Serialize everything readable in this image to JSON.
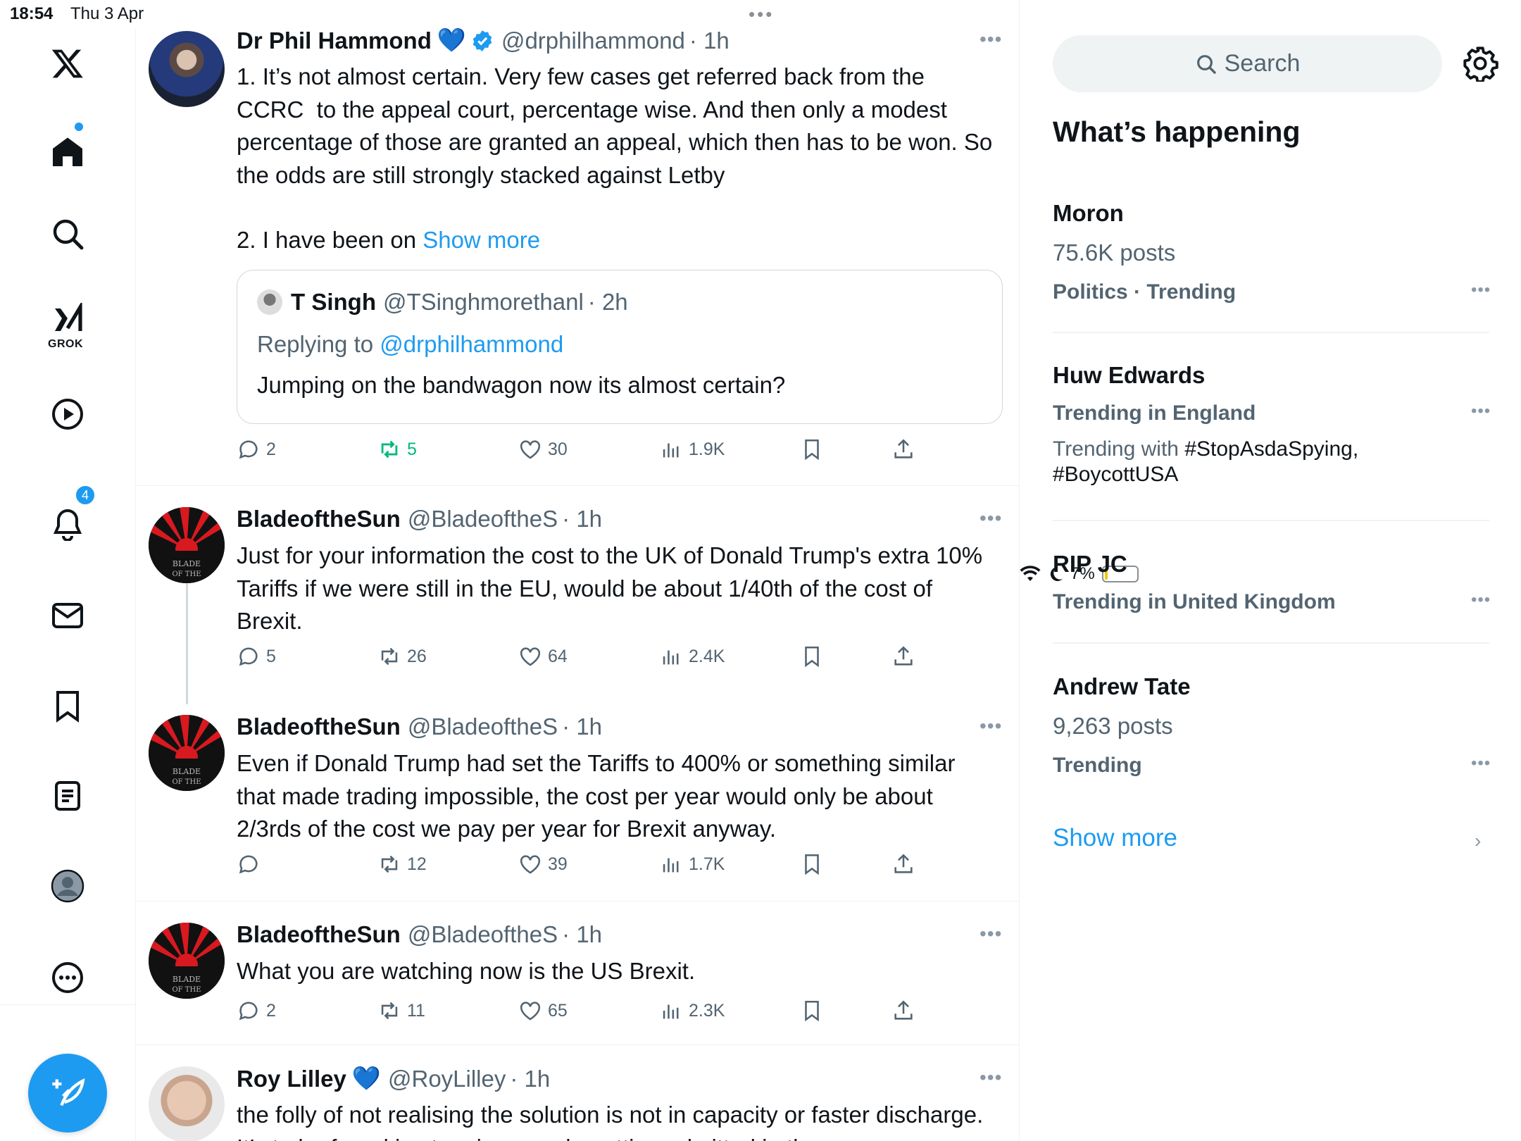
{
  "status_bar": {
    "time": "18:54",
    "date": "Thu 3 Apr",
    "battery": "7%"
  },
  "nav": {
    "grok_label": "GROK",
    "notifications_badge": "4"
  },
  "tweets": [
    {
      "name": "Dr Phil Hammond",
      "heart": "💙",
      "handle": "@drphilhammond",
      "time": "· 1h",
      "text": "1. It’s not almost certain. Very few cases get referred back from the CCRC  to the appeal court, percentage wise. And then only a modest percentage of those are granted an appeal, which then has to be won. So the odds are still strongly stacked against Letby",
      "text2": "2. I have been on ",
      "show_more": "Show more",
      "quote": {
        "name": "T Singh",
        "handle": "@TSinghmorethanl",
        "time": "· 2h",
        "replying_to": "Replying to ",
        "replying_handle": "@drphilhammond",
        "text": "Jumping on the bandwagon now its almost certain?"
      },
      "replies": "2",
      "reposts": "5",
      "likes": "30",
      "views": "1.9K"
    },
    {
      "name": "BladeoftheSun",
      "handle": "@BladeoftheS",
      "time": "· 1h",
      "text": "Just for your information the cost to the UK of Donald Trump's extra 10% Tariffs if we were still in the EU, would be about 1/40th of the cost of Brexit.",
      "replies": "5",
      "reposts": "26",
      "likes": "64",
      "views": "2.4K"
    },
    {
      "name": "BladeoftheSun",
      "handle": "@BladeoftheS",
      "time": "· 1h",
      "text": "Even if Donald Trump had set the Tariffs to 400% or something similar that made trading impossible, the cost per year would only be about 2/3rds of the cost we pay per year for Brexit anyway.",
      "replies": "",
      "reposts": "12",
      "likes": "39",
      "views": "1.7K"
    },
    {
      "name": "BladeoftheSun",
      "handle": "@BladeoftheS",
      "time": "· 1h",
      "text": "What you are watching now is the US Brexit.",
      "replies": "2",
      "reposts": "11",
      "likes": "65",
      "views": "2.3K"
    },
    {
      "name": "Roy Lilley",
      "heart": "💙",
      "handle": "@RoyLilley",
      "time": "· 1h",
      "text": "the folly of not realising the solution is not in capacity or faster discharge. It’s to be found in stopping people getting admitted in the"
    }
  ],
  "right_panel": {
    "search_placeholder": "Search",
    "title": "What’s happening",
    "trends": [
      {
        "name": "Moron",
        "posts": "75.6K posts",
        "context": "Politics · Trending"
      },
      {
        "name": "Huw Edwards",
        "context": "Trending in England",
        "with_label": "Trending with ",
        "with_tags": "#StopAsdaSpying, #BoycottUSA"
      },
      {
        "name": "RIP JC",
        "context": "Trending in United Kingdom"
      },
      {
        "name": "Andrew Tate",
        "posts": "9,263 posts",
        "context": "Trending"
      }
    ],
    "show_more": "Show more"
  },
  "colors": {
    "accent": "#1d9bf0",
    "repost_active": "#00ba7c",
    "muted": "#536471",
    "border": "#eff3f4"
  },
  "icons": [
    "x-logo-icon",
    "home-icon",
    "search-icon",
    "grok-icon",
    "video-icon",
    "bell-icon",
    "mail-icon",
    "bookmark-icon",
    "lists-icon",
    "profile-icon",
    "more-icon",
    "compose-icon",
    "reply-icon",
    "repost-icon",
    "like-icon",
    "views-icon",
    "share-icon",
    "gear-icon",
    "verified-icon",
    "wifi-icon",
    "moon-icon",
    "battery-icon"
  ]
}
